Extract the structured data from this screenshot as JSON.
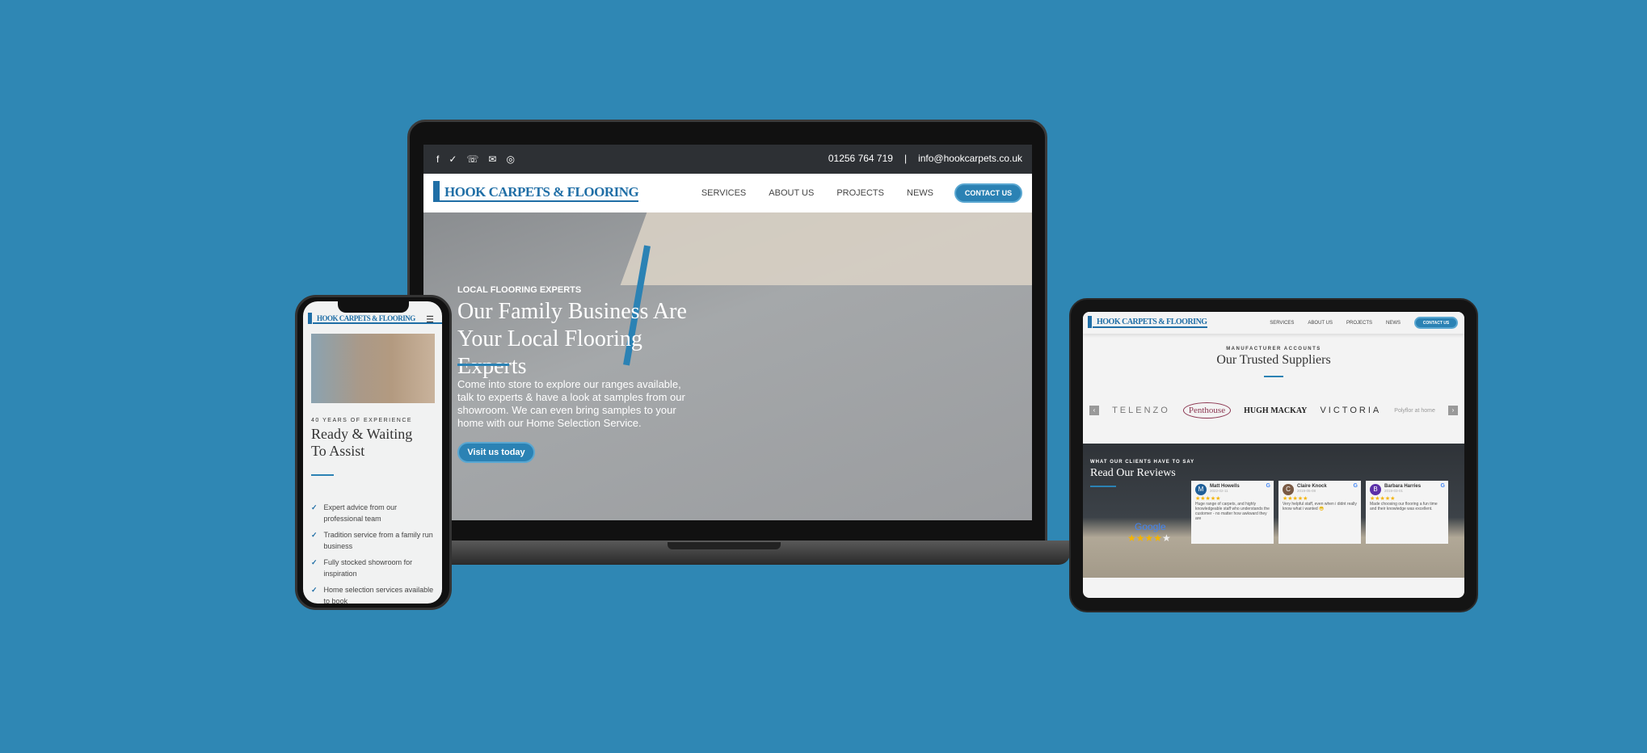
{
  "brand": {
    "logo": "HOOK CARPETS & FLOORING",
    "accent": "#2b82b4",
    "background": "#2f87b4"
  },
  "laptop": {
    "topbar": {
      "icons": [
        "facebook-icon",
        "checkatrade-icon",
        "phone-icon",
        "mail-icon",
        "instagram-icon"
      ],
      "phone": "01256 764 719",
      "separator": "|",
      "email": "info@hookcarpets.co.uk"
    },
    "nav": {
      "items": [
        "SERVICES",
        "ABOUT US",
        "PROJECTS",
        "NEWS"
      ],
      "cta": "CONTACT US"
    },
    "hero": {
      "eyebrow": "LOCAL FLOORING EXPERTS",
      "title": "Our Family Business Are Your Local Flooring Experts",
      "body": "Come into store to explore our ranges available, talk to experts & have a look at samples from our showroom. We can even bring samples to your home with our Home Selection Service.",
      "button": "Visit us today"
    }
  },
  "phone": {
    "eyebrow": "40 YEARS OF EXPERIENCE",
    "title": "Ready & Waiting To Assist",
    "list": [
      "Expert advice from our professional team",
      "Tradition service from a family run business",
      "Fully stocked showroom for inspiration",
      "Home selection services available to book"
    ]
  },
  "tablet": {
    "nav": {
      "items": [
        "SERVICES",
        "ABOUT US",
        "PROJECTS",
        "NEWS"
      ],
      "cta": "CONTACT US"
    },
    "suppliers": {
      "eyebrow": "MANUFACTURER ACCOUNTS",
      "title": "Our Trusted Suppliers",
      "logos": [
        "TELENZO",
        "Penthouse",
        "HUGH MACKAY",
        "VICTORIA",
        "Polyflor at home"
      ]
    },
    "reviews": {
      "eyebrow": "WHAT OUR CLIENTS HAVE TO SAY",
      "title": "Read Our Reviews",
      "google": "Google",
      "google_rating": 4.5,
      "cards": [
        {
          "initial": "M",
          "name": "Matt Howells",
          "date": "2022-02-11",
          "color": "#1f5f99",
          "stars": "★★★★★",
          "text": "Huge range of carpets, and highly knowledgeable staff who understands the customer - no matter how awkward they are"
        },
        {
          "initial": "C",
          "name": "Claire Knock",
          "date": "2019-05-08",
          "color": "#7a5a44",
          "stars": "★★★★★",
          "text": "Very helpful staff, even when i didnt really know what i wanted 😁"
        },
        {
          "initial": "B",
          "name": "Barbara Harries",
          "date": "2019-03-01",
          "color": "#5b2fa8",
          "stars": "★★★★★",
          "text": "Made choosing our flooring a fun time and their knowledge was excellent."
        }
      ]
    }
  }
}
